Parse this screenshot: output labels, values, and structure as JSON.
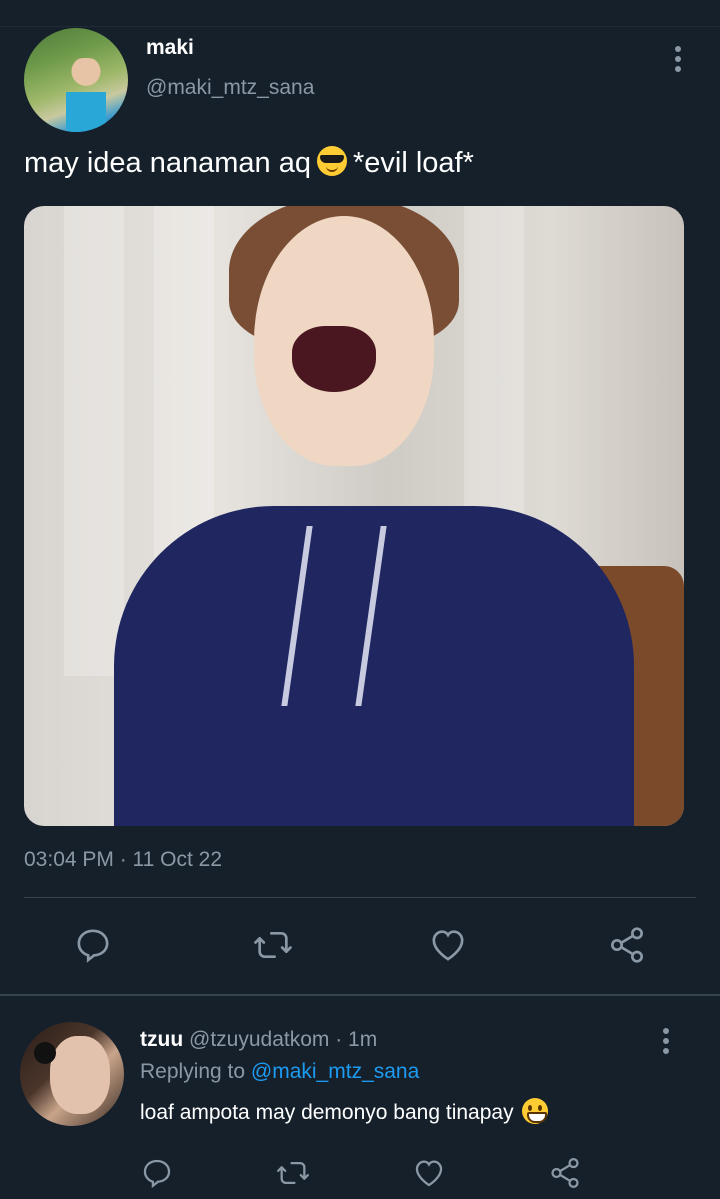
{
  "main_tweet": {
    "author_name": "maki",
    "author_handle": "@maki_mtz_sana",
    "text_before_emoji": "may idea nanaman aq",
    "emoji": "smiling-face-with-sunglasses",
    "text_after_emoji": "*evil loaf*",
    "timestamp": "03:04 PM · 11 Oct 22",
    "media_alt": "photo"
  },
  "reply": {
    "author_name": "tzuu",
    "meta": "@tzuyudatkom · 1m",
    "replying_prefix": "Replying to",
    "replying_to": "@maki_mtz_sana",
    "text": "loaf ampota may demonyo bang tinapay",
    "emoji": "grinning-face"
  },
  "icons": [
    "reply-icon",
    "retweet-icon",
    "like-icon",
    "share-icon",
    "more-icon"
  ],
  "colors": {
    "background": "#15202b",
    "muted": "#8b98a5",
    "link": "#1d9bf0",
    "divider": "#38444d"
  }
}
